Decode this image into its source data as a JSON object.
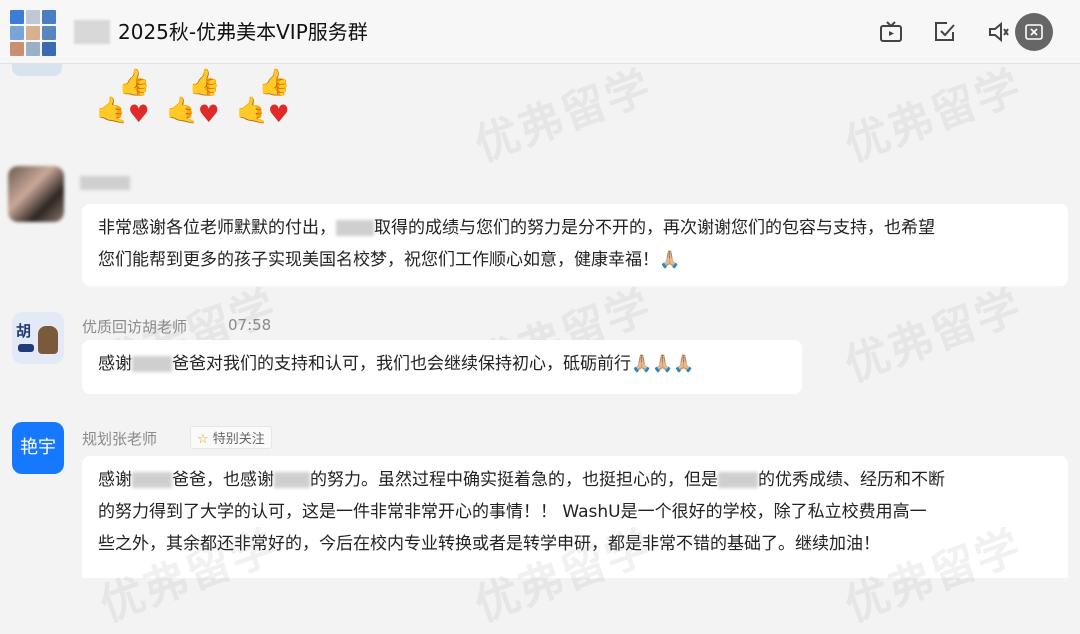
{
  "header": {
    "title": "2025秋-优弗美本VIP服务群"
  },
  "watermark": "优弗留学",
  "messages": [
    {
      "sender": "",
      "text_line1": "非常感谢各位老师默默的付出，",
      "text_line1b": "取得的成绩与您们的努力是分不开的，再次谢谢您们的包容与支持，也希望",
      "text_line2": "您们能帮到更多的孩子实现美国名校梦，祝您们工作顺心如意，健康幸福！",
      "emoji": "🙏🏼"
    },
    {
      "sender": "优质回访胡老师",
      "time": "07:58",
      "text_a": "感谢",
      "text_b": "爸爸对我们的支持和认可，我们也会继续保持初心，砥砺前行",
      "emoji": "🙏🏼🙏🏼🙏🏼",
      "avatar_text": "胡"
    },
    {
      "sender": "规划张老师",
      "badge": "特别关注",
      "avatar_text": "艳宇",
      "line1_a": "感谢",
      "line1_b": "爸爸，也感谢",
      "line1_c": "的努力。虽然过程中确实挺着急的，也挺担心的，但是",
      "line1_d": "的优秀成绩、经历和不断",
      "line2": "的努力得到了大学的认可，这是一件非常非常开心的事情！！ WashU是一个很好的学校，除了私立校费用高一",
      "line3": "些之外，其余都还非常好的，今后在校内专业转换或者是转学申研，都是非常不错的基础了。继续加油！"
    }
  ],
  "colors": {
    "accent": "#1677ff",
    "badge_star": "#e8a317"
  }
}
